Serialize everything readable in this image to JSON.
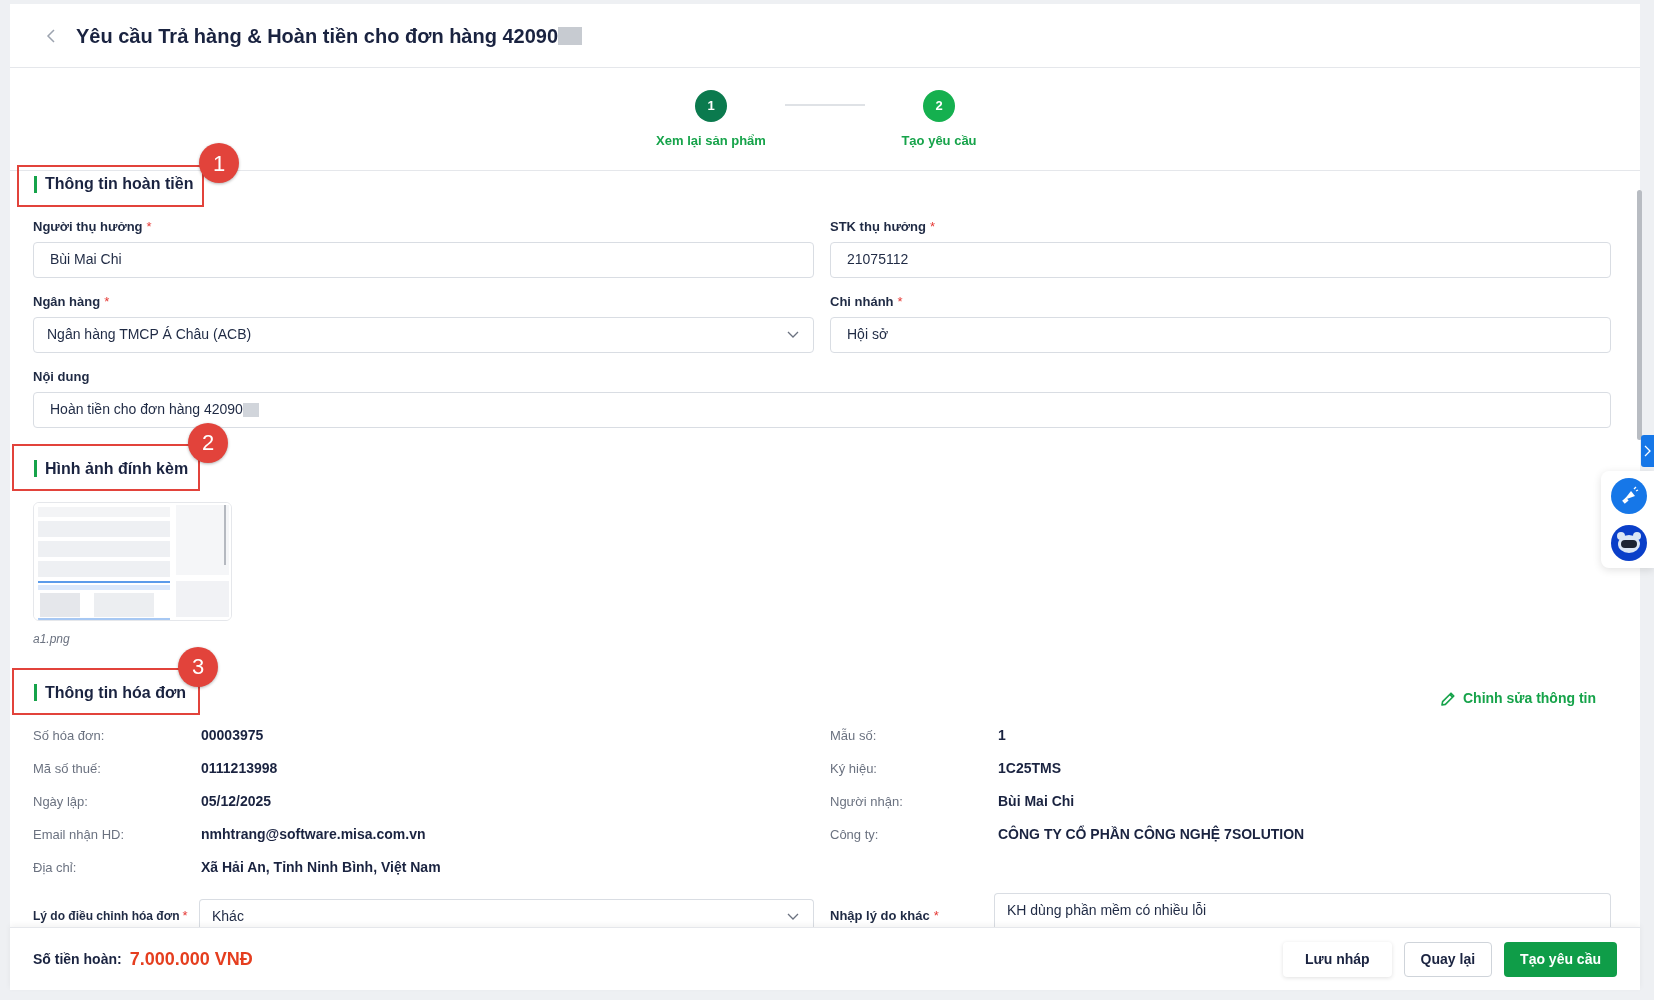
{
  "header": {
    "title": "Yêu cầu Trả hàng & Hoàn tiền cho đơn hàng 42090",
    "redacted": true
  },
  "steps": [
    {
      "number": "1",
      "label": "Xem lại sản phẩm",
      "selected": false
    },
    {
      "number": "2",
      "label": "Tạo yêu cầu",
      "selected": true
    }
  ],
  "refund_section": {
    "title": "Thông tin hoàn tiền",
    "annotation": "1",
    "fields": [
      {
        "label": "Người thụ hưởng",
        "required": "*",
        "value": "Bùi Mai Chi",
        "kind": "text"
      },
      {
        "label": "STK thụ hưởng",
        "required": "*",
        "value": "21075112",
        "kind": "text"
      },
      {
        "label": "Ngân hàng",
        "required": "*",
        "value": "Ngân hàng TMCP Á Châu (ACB)",
        "kind": "select"
      },
      {
        "label": "Chi nhánh",
        "required": "*",
        "value": "Hội sở",
        "kind": "text"
      },
      {
        "label": "Nội dung",
        "value": "Hoàn tiền cho đơn hàng 42090",
        "kind": "wide",
        "redacted": true
      }
    ]
  },
  "attachments": {
    "title": "Hình ảnh đính kèm",
    "annotation": "2",
    "files": [
      {
        "name": "a1.png",
        "kind": "picture"
      }
    ]
  },
  "invoice_section": {
    "title": "Thông tin hóa đơn",
    "annotation": "3",
    "edit_link": "Chỉnh sửa thông tin",
    "left": [
      {
        "label": "Số hóa đơn:",
        "value": "00003975"
      },
      {
        "label": "Mã số thuế:",
        "value": "0111213998"
      },
      {
        "label": "Ngày lập:",
        "value": "05/12/2025"
      },
      {
        "label": "Email nhận HD:",
        "value": "nmhtrang@software.misa.com.vn"
      },
      {
        "label": "Địa chỉ:",
        "value": "Xã Hải An, Tỉnh Ninh Bình, Việt Nam"
      }
    ],
    "right": [
      {
        "label": "Mẫu số:",
        "value": "1"
      },
      {
        "label": "Ký hiệu:",
        "value": "1C25TMS"
      },
      {
        "label": "Người nhận:",
        "value": "Bùi Mai Chi"
      },
      {
        "label": "Công ty:",
        "value": "CÔNG TY CỔ PHẦN CÔNG NGHỆ 7SOLUTION"
      }
    ],
    "reason": {
      "label": "Lý do điều chỉnh hóa đơn",
      "required": "*",
      "value": "Khác"
    },
    "other_reason": {
      "label": "Nhập lý do khác",
      "required": "*",
      "value": "KH dùng phần mềm có nhiều lỗi"
    }
  },
  "footer": {
    "label": "Số tiền hoàn:",
    "amount": "7.000.000 VNĐ",
    "buttons": [
      {
        "label": "Lưu nháp",
        "kind": "plain"
      },
      {
        "label": "Quay lại",
        "kind": "outline"
      },
      {
        "label": "Tạo yêu cầu",
        "kind": "primary"
      }
    ]
  }
}
